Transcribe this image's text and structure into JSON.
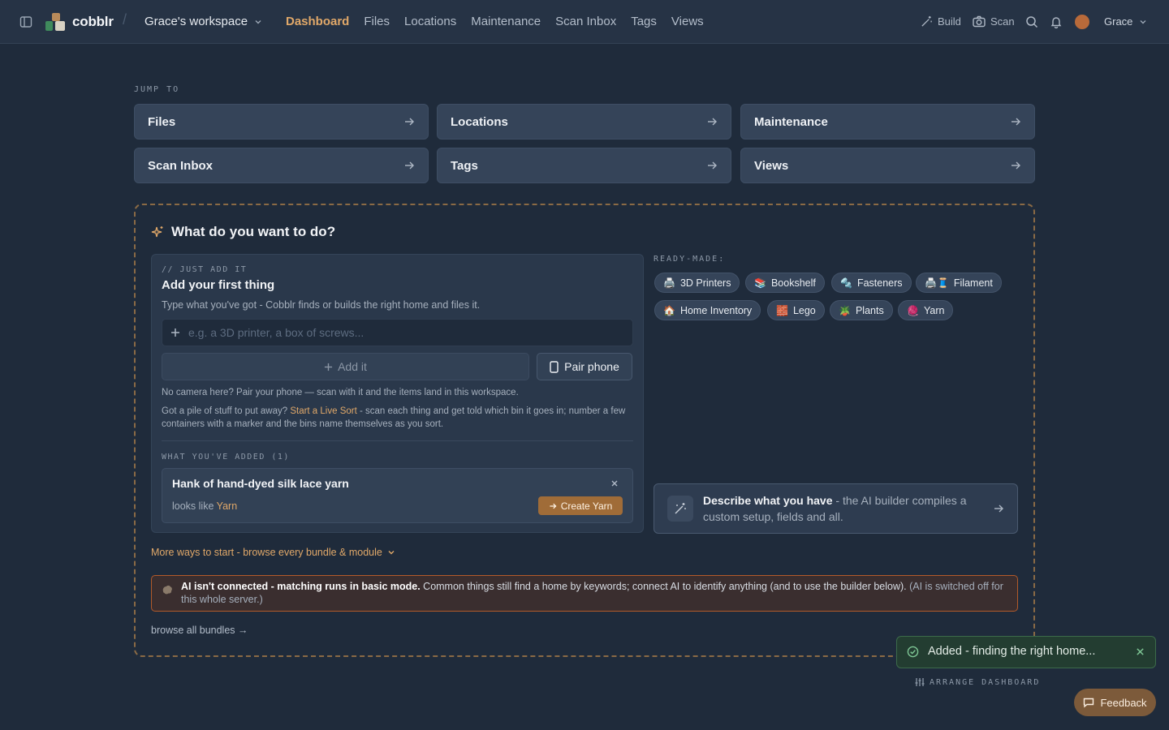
{
  "topbar": {
    "brand": "cobblr",
    "separator": "/",
    "workspace": "Grace's workspace",
    "nav": [
      "Dashboard",
      "Files",
      "Locations",
      "Maintenance",
      "Scan Inbox",
      "Tags",
      "Views"
    ],
    "active_nav": "Dashboard",
    "build_label": "Build",
    "scan_label": "Scan",
    "user": "Grace"
  },
  "jump": {
    "label": "JUMP TO",
    "cards": [
      "Files",
      "Locations",
      "Maintenance",
      "Scan Inbox",
      "Tags",
      "Views"
    ]
  },
  "panel": {
    "title": "What do you want to do?",
    "comment": "// JUST ADD IT",
    "add_title": "Add your first thing",
    "add_sub": "Type what you've got - Cobblr finds or builds the right home and files it.",
    "input_placeholder": "e.g. a 3D printer, a box of screws...",
    "add_button": "Add it",
    "pair_button": "Pair phone",
    "note_camera": "No camera here? Pair your phone — scan with it and the items land in this workspace.",
    "note_sort_pre": "Got a pile of stuff to put away? ",
    "note_sort_link": "Start a Live Sort",
    "note_sort_post": " - scan each thing and get told which bin it goes in; number a few containers with a marker and the bins name themselves as you sort.",
    "added_label": "WHAT YOU'VE ADDED (1)",
    "item_name": "Hank of hand-dyed silk lace yarn",
    "item_hint_pre": "looks like ",
    "item_hint_link": "Yarn",
    "create_button": "Create Yarn",
    "ready_label": "READY-MADE:",
    "chips": [
      {
        "emoji": "🖨️",
        "label": "3D Printers"
      },
      {
        "emoji": "📚",
        "label": "Bookshelf"
      },
      {
        "emoji": "🔩",
        "label": "Fasteners"
      },
      {
        "emoji": "🖨️🧵",
        "label": "Filament"
      },
      {
        "emoji": "🏠",
        "label": "Home Inventory"
      },
      {
        "emoji": "🧱",
        "label": "Lego"
      },
      {
        "emoji": "🪴",
        "label": "Plants"
      },
      {
        "emoji": "🧶",
        "label": "Yarn"
      }
    ],
    "describe_bold": "Describe what you have",
    "describe_rest": " - the AI builder compiles a custom setup, fields and all.",
    "more_ways": "More ways to start - browse every bundle & module",
    "ai_bold": "AI isn't connected - matching runs in basic mode.",
    "ai_text": " Common things still find a home by keywords; connect AI to identify anything (and to use the builder below).",
    "ai_muted": " (AI is switched off for this whole server.)",
    "browse": "browse all bundles →"
  },
  "toast": {
    "text": "Added - finding the right home..."
  },
  "arrange_label": "ARRANGE DASHBOARD",
  "feedback_label": "Feedback",
  "colors": {
    "background": "#1f2b3b",
    "accent": "#e0a869",
    "card": "#354459",
    "warning_border": "#b35a2a",
    "toast_bg": "#233d31"
  }
}
